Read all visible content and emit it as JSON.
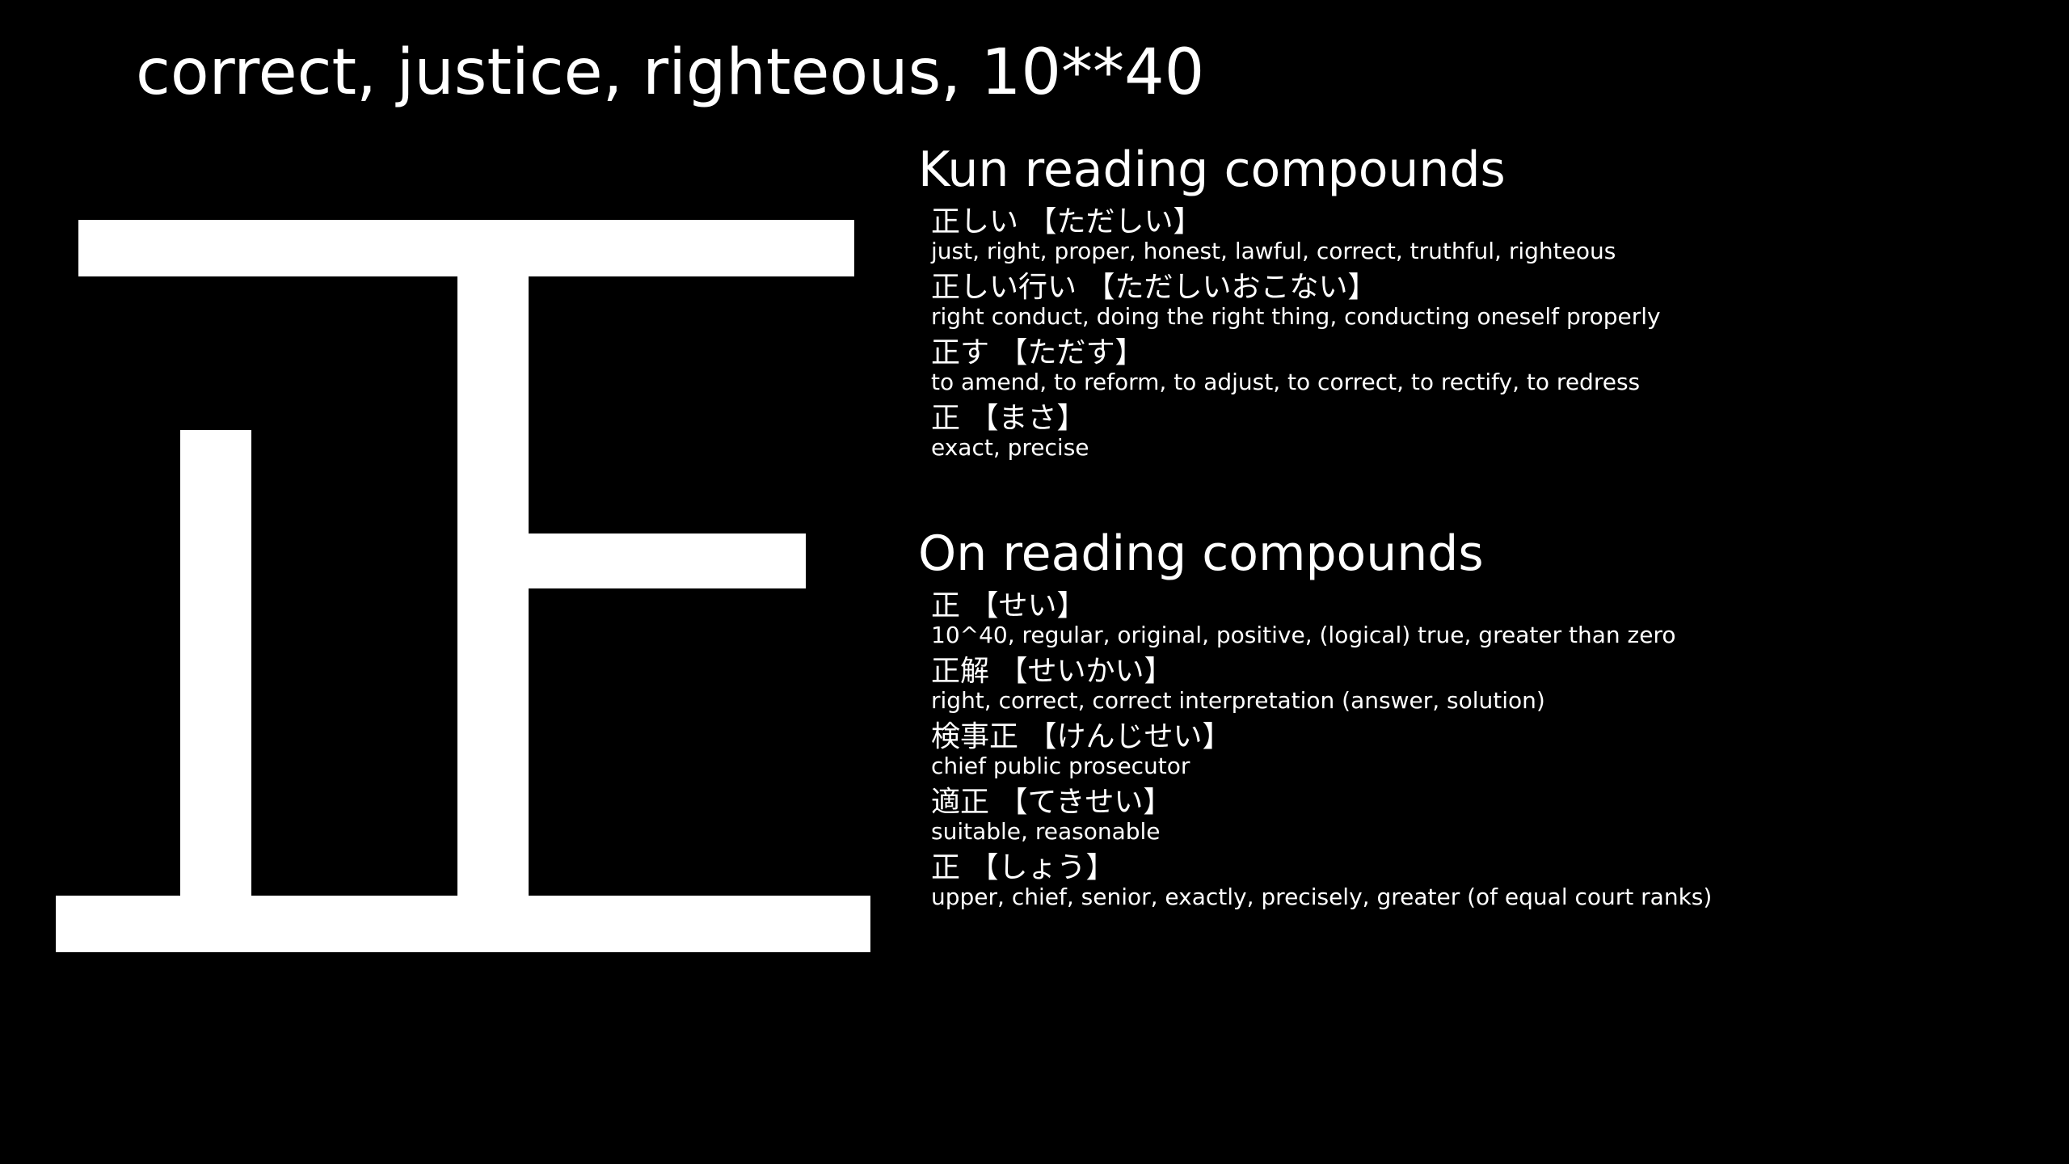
{
  "meaning": "correct, justice, righteous, 10**40",
  "kanji": "正",
  "kun": {
    "heading": "Kun reading compounds",
    "items": [
      {
        "word": "正しい 【ただしい】",
        "gloss": "just, right, proper, honest, lawful, correct, truthful, righteous"
      },
      {
        "word": "正しい行い 【ただしいおこない】",
        "gloss": "right conduct, doing the right thing, conducting oneself properly"
      },
      {
        "word": "正す 【ただす】",
        "gloss": "to amend, to reform, to adjust, to correct, to rectify, to redress"
      },
      {
        "word": "正 【まさ】",
        "gloss": "exact, precise"
      }
    ]
  },
  "on": {
    "heading": "On reading compounds",
    "items": [
      {
        "word": "正 【せい】",
        "gloss": "10^40, regular, original, positive, (logical) true, greater than zero"
      },
      {
        "word": "正解 【せいかい】",
        "gloss": "right, correct, correct interpretation (answer, solution)"
      },
      {
        "word": "検事正 【けんじせい】",
        "gloss": "chief public prosecutor"
      },
      {
        "word": "適正 【てきせい】",
        "gloss": "suitable, reasonable"
      },
      {
        "word": "正 【しょう】",
        "gloss": "upper, chief, senior, exactly, precisely, greater (of equal court ranks)"
      }
    ]
  }
}
